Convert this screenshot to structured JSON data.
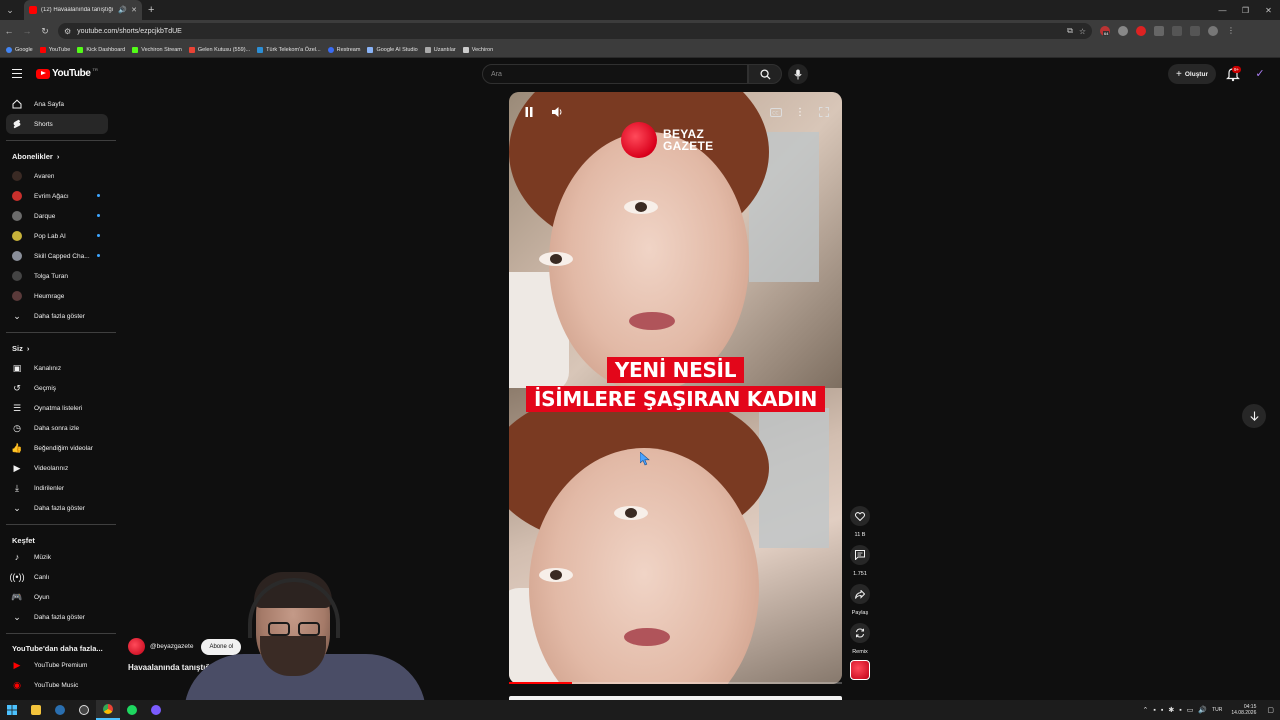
{
  "browser": {
    "tab_title": "(12) Havaalanında tanıştığı",
    "url": "youtube.com/shorts/ezpcjkbTdUE",
    "bookmarks": [
      "Google",
      "YouTube",
      "Kick Dashboard",
      "Vechiron Stream",
      "Gelen Kutusu (559)...",
      "Türk Telekom'a Özel...",
      "Restream",
      "Google AI Studio",
      "Uzantılar",
      "Vechiron"
    ],
    "extension_badge": "64"
  },
  "header": {
    "logo_text": "YouTube",
    "logo_country": "TR",
    "search_placeholder": "Ara",
    "create_label": "Oluştur",
    "notif_badge": "9+"
  },
  "sidebar": {
    "main": [
      {
        "label": "Ana Sayfa",
        "icon": "home-icon"
      },
      {
        "label": "Shorts",
        "icon": "shorts-icon"
      }
    ],
    "subs_heading": "Abonelikler",
    "subs": [
      {
        "label": "Avaren",
        "color": "#3a2a24",
        "new": false
      },
      {
        "label": "Evrim Ağacı",
        "color": "#c9302c",
        "new": true
      },
      {
        "label": "Darque",
        "color": "#6b6b6b",
        "new": true
      },
      {
        "label": "Pop Lab AI",
        "color": "#c7b23a",
        "new": true
      },
      {
        "label": "Skill Capped Cha...",
        "color": "#8a8f9a",
        "new": true
      },
      {
        "label": "Tolga Turan",
        "color": "#444444",
        "new": false
      },
      {
        "label": "Heumrage",
        "color": "#5a3a3a",
        "new": false
      }
    ],
    "more_label": "Daha fazla göster",
    "you_heading": "Siz",
    "you": [
      {
        "label": "Kanalınız",
        "icon": "channel-icon"
      },
      {
        "label": "Geçmiş",
        "icon": "history-icon"
      },
      {
        "label": "Oynatma listeleri",
        "icon": "playlist-icon"
      },
      {
        "label": "Daha sonra izle",
        "icon": "clock-icon"
      },
      {
        "label": "Beğendiğim videolar",
        "icon": "thumbs-up-icon"
      },
      {
        "label": "Videolarınız",
        "icon": "video-icon"
      },
      {
        "label": "İndirilenler",
        "icon": "download-icon"
      },
      {
        "label": "Daha fazla göster",
        "icon": "chevron-down-icon"
      }
    ],
    "explore_heading": "Keşfet",
    "explore": [
      {
        "label": "Müzik",
        "icon": "music-icon"
      },
      {
        "label": "Canlı",
        "icon": "live-icon"
      },
      {
        "label": "Oyun",
        "icon": "game-icon"
      },
      {
        "label": "Daha fazla göster",
        "icon": "chevron-down-icon"
      }
    ],
    "more_yt_heading": "YouTube'dan daha fazla...",
    "more_yt": [
      {
        "label": "YouTube Premium"
      },
      {
        "label": "YouTube Music"
      }
    ]
  },
  "short": {
    "brand_line1": "BEYAZ",
    "brand_line2": "GAZETE",
    "caption_line1": "YENİ NESİL",
    "caption_line2": "İSİMLERE ŞAŞIRAN KADIN",
    "progress_fraction": 0.19,
    "channel": "@beyazgazete",
    "subscribe_label": "Abone ol",
    "title": "Havaalanında tanıştığı"
  },
  "actions": {
    "likes": "11 B",
    "comments": "1.751",
    "share_label": "Paylaş",
    "remix_label": "Remix"
  },
  "taskbar": {
    "lang": "TUR",
    "time": "04:15",
    "date": "14.08.2026"
  }
}
